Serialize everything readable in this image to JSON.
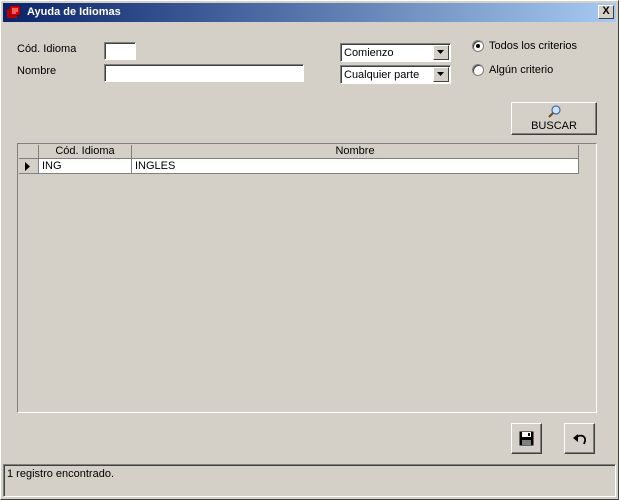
{
  "window": {
    "title": "Ayuda de Idiomas",
    "close_label": "X"
  },
  "form": {
    "codigo_label": "Cód. Idioma",
    "codigo_value": "",
    "nombre_label": "Nombre",
    "nombre_value": "",
    "combo1_value": "Comienzo",
    "combo2_value": "Cualquier parte",
    "radio_all_label": "Todos los criterios",
    "radio_any_label": "Algún criterio",
    "radio_selected": "all"
  },
  "search_button": {
    "label": "BUSCAR",
    "icon": "magnifier-icon"
  },
  "grid": {
    "columns": [
      "Cód. Idioma",
      "Nombre"
    ],
    "rows": [
      {
        "codigo": "ING",
        "nombre": "INGLES"
      }
    ]
  },
  "footer": {
    "save_icon": "floppy-disk-icon",
    "undo_icon": "undo-arrow-icon"
  },
  "status": {
    "text": "1 registro encontrado."
  }
}
